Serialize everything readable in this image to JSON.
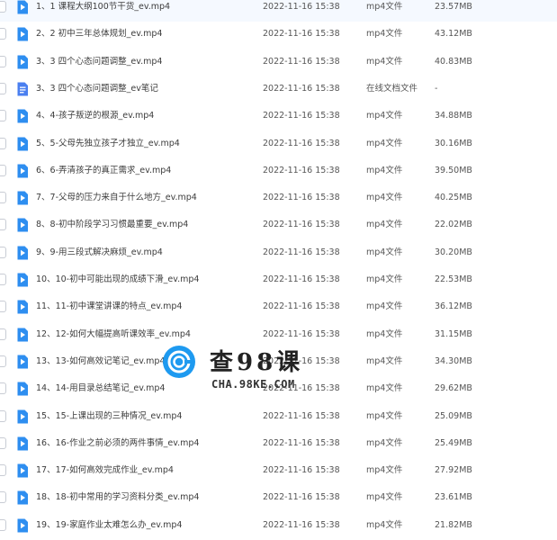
{
  "colors": {
    "video_icon": "#2e8ef0",
    "doc_icon": "#4a7ff0",
    "watermark_badge": "#1e9af0"
  },
  "files": [
    {
      "name": "1、1 课程大纲100节干货_ev.mp4",
      "date": "2022-11-16 15:38",
      "type": "mp4文件",
      "size": "23.57MB",
      "icon": "video-file-icon"
    },
    {
      "name": "2、2 初中三年总体规划_ev.mp4",
      "date": "2022-11-16 15:38",
      "type": "mp4文件",
      "size": "43.12MB",
      "icon": "video-file-icon"
    },
    {
      "name": "3、3 四个心态问题调整_ev.mp4",
      "date": "2022-11-16 15:38",
      "type": "mp4文件",
      "size": "40.83MB",
      "icon": "video-file-icon"
    },
    {
      "name": "3、3 四个心态问题调整_ev笔记",
      "date": "2022-11-16 15:38",
      "type": "在线文档文件",
      "size": "-",
      "icon": "document-file-icon"
    },
    {
      "name": "4、4-孩子叛逆的根源_ev.mp4",
      "date": "2022-11-16 15:38",
      "type": "mp4文件",
      "size": "34.88MB",
      "icon": "video-file-icon"
    },
    {
      "name": "5、5-父母先独立孩子才独立_ev.mp4",
      "date": "2022-11-16 15:38",
      "type": "mp4文件",
      "size": "30.16MB",
      "icon": "video-file-icon"
    },
    {
      "name": "6、6-弄清孩子的真正需求_ev.mp4",
      "date": "2022-11-16 15:38",
      "type": "mp4文件",
      "size": "39.50MB",
      "icon": "video-file-icon"
    },
    {
      "name": "7、7-父母的压力来自于什么地方_ev.mp4",
      "date": "2022-11-16 15:38",
      "type": "mp4文件",
      "size": "40.25MB",
      "icon": "video-file-icon"
    },
    {
      "name": "8、8-初中阶段学习习惯最重要_ev.mp4",
      "date": "2022-11-16 15:38",
      "type": "mp4文件",
      "size": "22.02MB",
      "icon": "video-file-icon"
    },
    {
      "name": "9、9-用三段式解决麻烦_ev.mp4",
      "date": "2022-11-16 15:38",
      "type": "mp4文件",
      "size": "30.20MB",
      "icon": "video-file-icon"
    },
    {
      "name": "10、10-初中可能出现的成绩下滑_ev.mp4",
      "date": "2022-11-16 15:38",
      "type": "mp4文件",
      "size": "22.53MB",
      "icon": "video-file-icon"
    },
    {
      "name": "11、11-初中课堂讲课的特点_ev.mp4",
      "date": "2022-11-16 15:38",
      "type": "mp4文件",
      "size": "36.12MB",
      "icon": "video-file-icon"
    },
    {
      "name": "12、12-如何大幅提高听课效率_ev.mp4",
      "date": "2022-11-16 15:38",
      "type": "mp4文件",
      "size": "31.15MB",
      "icon": "video-file-icon"
    },
    {
      "name": "13、13-如何高效记笔记_ev.mp4",
      "date": "2022-11-16 15:38",
      "type": "mp4文件",
      "size": "34.30MB",
      "icon": "video-file-icon"
    },
    {
      "name": "14、14-用目录总结笔记_ev.mp4",
      "date": "2022-11-16 15:38",
      "type": "mp4文件",
      "size": "29.62MB",
      "icon": "video-file-icon"
    },
    {
      "name": "15、15-上课出现的三种情况_ev.mp4",
      "date": "2022-11-16 15:38",
      "type": "mp4文件",
      "size": "25.09MB",
      "icon": "video-file-icon"
    },
    {
      "name": "16、16-作业之前必须的两件事情_ev.mp4",
      "date": "2022-11-16 15:38",
      "type": "mp4文件",
      "size": "25.49MB",
      "icon": "video-file-icon"
    },
    {
      "name": "17、17-如何高效完成作业_ev.mp4",
      "date": "2022-11-16 15:38",
      "type": "mp4文件",
      "size": "27.92MB",
      "icon": "video-file-icon"
    },
    {
      "name": "18、18-初中常用的学习资料分类_ev.mp4",
      "date": "2022-11-16 15:38",
      "type": "mp4文件",
      "size": "23.61MB",
      "icon": "video-file-icon"
    },
    {
      "name": "19、19-家庭作业太难怎么办_ev.mp4",
      "date": "2022-11-16 15:38",
      "type": "mp4文件",
      "size": "21.82MB",
      "icon": "video-file-icon"
    }
  ],
  "watermark": {
    "title": "查98课",
    "domain": "CHA.98KE.COM"
  }
}
